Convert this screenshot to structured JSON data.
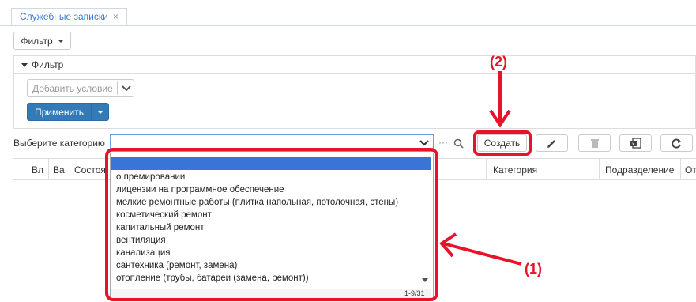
{
  "tab": {
    "label": "Служебные записки",
    "close": "×"
  },
  "filter_button": "Фильтр",
  "filter_panel": {
    "title": "Фильтр",
    "add_condition_placeholder": "Добавить условие",
    "apply_label": "Применить"
  },
  "toolbar": {
    "category_label": "Выберите категорию",
    "more_glyph": "···",
    "create_label": "Создать"
  },
  "columns": [
    "Вл",
    "Ва",
    "Состоя",
    "Категория",
    "Подразделение",
    "От"
  ],
  "dropdown": {
    "options": [
      "о премировании",
      "лицензии на программное обеспечение",
      "мелкие ремонтные работы (плитка напольная, потолочная, стены)",
      "косметический ремонт",
      "капитальный ремонт",
      "вентиляция",
      "канализация",
      "сантехника (ремонт, замена)",
      "отопление (трубы, батареи (замена, ремонт))"
    ],
    "pager": "1-9/31"
  },
  "annotations": {
    "one": "(1)",
    "two": "(2)"
  },
  "colors": {
    "accent": "#337ab7",
    "highlight": "#e8122b",
    "selected": "#3875d7"
  }
}
